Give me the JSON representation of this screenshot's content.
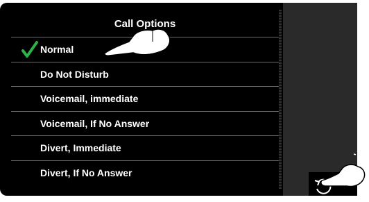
{
  "header": {
    "title": "Call Options"
  },
  "menu": {
    "items": [
      {
        "label": "Normal",
        "selected": true
      },
      {
        "label": "Do Not Disturb",
        "selected": false
      },
      {
        "label": "Voicemail, immediate",
        "selected": false
      },
      {
        "label": "Voicemail, If No Answer",
        "selected": false
      },
      {
        "label": "Divert, Immediate",
        "selected": false
      },
      {
        "label": "Divert, If No Answer",
        "selected": false
      }
    ]
  },
  "icons": {
    "check": "checkmark-icon",
    "back": "back-arrow-icon",
    "pointer": "pointing-hand-icon",
    "tap": "tapping-hand-icon"
  },
  "colors": {
    "background": "#000000",
    "text": "#ffffff",
    "check": "#2bb34a",
    "divider": "#6b6b6b",
    "side_panel": "#2a2a2a"
  }
}
